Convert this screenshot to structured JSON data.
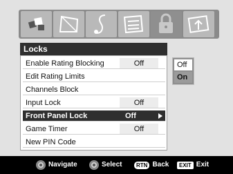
{
  "menu": {
    "title": "Locks",
    "rows": [
      {
        "label": "Enable Rating Blocking",
        "value": "Off"
      },
      {
        "label": "Edit Rating Limits",
        "value": ""
      },
      {
        "label": "Channels Block",
        "value": ""
      },
      {
        "label": "Input Lock",
        "value": "Off"
      },
      {
        "label": "Front Panel Lock",
        "value": "Off"
      },
      {
        "label": "Game Timer",
        "value": "Off"
      },
      {
        "label": "New PIN Code",
        "value": ""
      }
    ]
  },
  "popup": {
    "options": [
      "Off",
      "On"
    ],
    "selected": "On"
  },
  "navbar": {
    "navigate": "Navigate",
    "select": "Select",
    "rtn_key": "RTN",
    "back": "Back",
    "exit_key": "EXIT",
    "exit": "Exit"
  },
  "icons": [
    "picture-icon",
    "audio-icon",
    "music-icon",
    "setup-icon",
    "lock-icon",
    "preferences-icon"
  ]
}
